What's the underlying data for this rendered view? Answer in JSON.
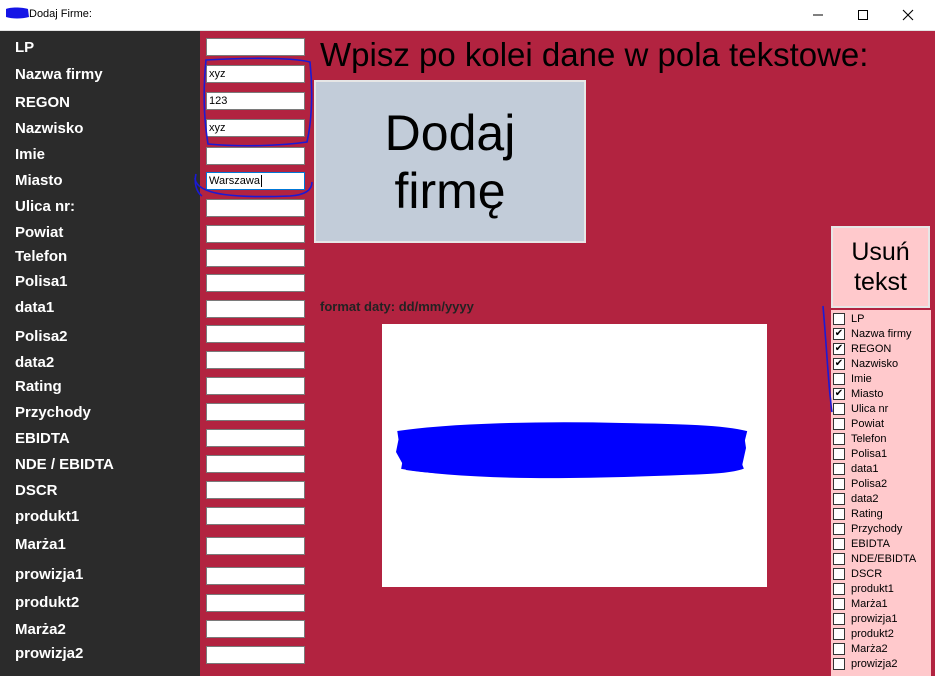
{
  "window": {
    "title": "Dodaj Firme:",
    "minimize_icon": "minimize-icon",
    "maximize_icon": "maximize-icon",
    "close_icon": "close-icon"
  },
  "fields": [
    {
      "label": "LP",
      "value": ""
    },
    {
      "label": "Nazwa firmy",
      "value": "xyz"
    },
    {
      "label": "REGON",
      "value": "123"
    },
    {
      "label": "Nazwisko",
      "value": "xyz"
    },
    {
      "label": "Imie",
      "value": ""
    },
    {
      "label": "Miasto",
      "value": "Warszawa"
    },
    {
      "label": "Ulica nr:",
      "value": ""
    },
    {
      "label": "Powiat",
      "value": ""
    },
    {
      "label": "Telefon",
      "value": ""
    },
    {
      "label": "Polisa1",
      "value": ""
    },
    {
      "label": "data1",
      "value": ""
    },
    {
      "label": "Polisa2",
      "value": ""
    },
    {
      "label": "data2",
      "value": ""
    },
    {
      "label": "Rating",
      "value": ""
    },
    {
      "label": "Przychody",
      "value": ""
    },
    {
      "label": "EBIDTA",
      "value": ""
    },
    {
      "label": "NDE / EBIDTA",
      "value": ""
    },
    {
      "label": "DSCR",
      "value": ""
    },
    {
      "label": "produkt1",
      "value": ""
    },
    {
      "label": "Marża1",
      "value": ""
    },
    {
      "label": "prowizja1",
      "value": ""
    },
    {
      "label": "produkt2",
      "value": ""
    },
    {
      "label": "Marża2",
      "value": ""
    },
    {
      "label": "prowizja2",
      "value": ""
    }
  ],
  "main": {
    "headline": "Wpisz po kolei dane w pola tekstowe:",
    "add_button_line1": "Dodaj",
    "add_button_line2": "firmę",
    "clear_button_line1": "Usuń",
    "clear_button_line2": "tekst",
    "date_format_hint": "format daty: dd/mm/yyyy"
  },
  "checkboxes": [
    {
      "label": "LP",
      "checked": false
    },
    {
      "label": "Nazwa firmy",
      "checked": true
    },
    {
      "label": "REGON",
      "checked": true
    },
    {
      "label": "Nazwisko",
      "checked": true
    },
    {
      "label": "Imie",
      "checked": false
    },
    {
      "label": "Miasto",
      "checked": true
    },
    {
      "label": "Ulica nr",
      "checked": false
    },
    {
      "label": "Powiat",
      "checked": false
    },
    {
      "label": "Telefon",
      "checked": false
    },
    {
      "label": "Polisa1",
      "checked": false
    },
    {
      "label": "data1",
      "checked": false
    },
    {
      "label": "Polisa2",
      "checked": false
    },
    {
      "label": "data2",
      "checked": false
    },
    {
      "label": "Rating",
      "checked": false
    },
    {
      "label": "Przychody",
      "checked": false
    },
    {
      "label": "EBIDTA",
      "checked": false
    },
    {
      "label": "NDE/EBIDTA",
      "checked": false
    },
    {
      "label": "DSCR",
      "checked": false
    },
    {
      "label": "produkt1",
      "checked": false
    },
    {
      "label": "Marża1",
      "checked": false
    },
    {
      "label": "prowizja1",
      "checked": false
    },
    {
      "label": "produkt2",
      "checked": false
    },
    {
      "label": "Marża2",
      "checked": false
    },
    {
      "label": "prowizja2",
      "checked": false
    }
  ],
  "colors": {
    "background": "#b22340",
    "sidebar": "#2b2b2b",
    "add_button": "#c2ccd9",
    "clear_button": "#ffc9cc",
    "checkbox_panel": "#ffc9cc",
    "annotation_ink": "#1a1ad6",
    "redaction": "#0000ff"
  }
}
